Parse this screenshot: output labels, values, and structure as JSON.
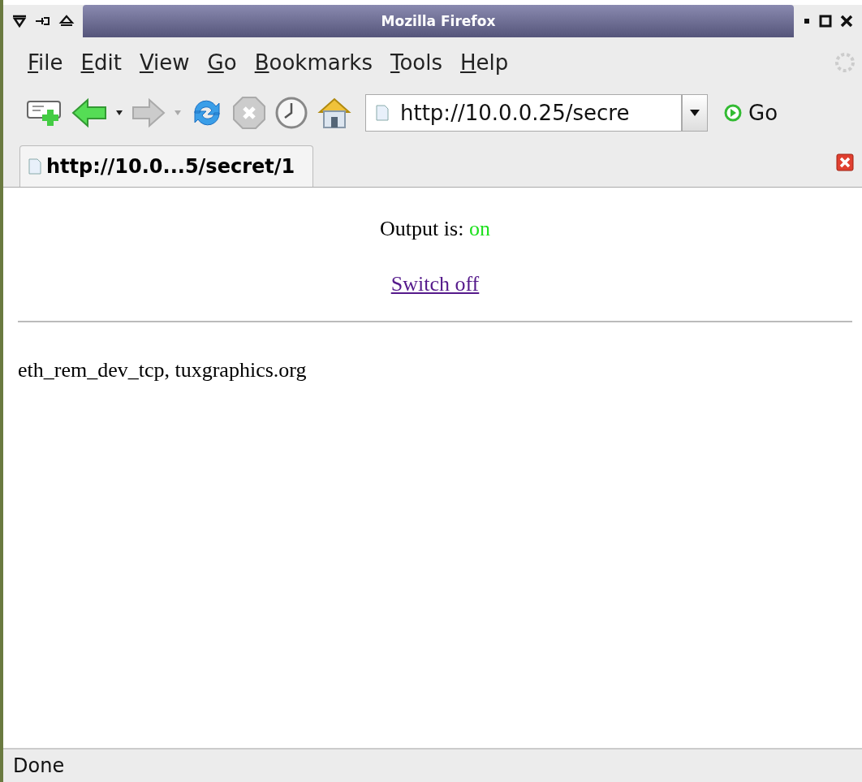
{
  "window": {
    "title": "Mozilla Firefox"
  },
  "menu": [
    "File",
    "Edit",
    "View",
    "Go",
    "Bookmarks",
    "Tools",
    "Help"
  ],
  "toolbar": {
    "url": "http://10.0.0.25/secre",
    "go_label": "Go"
  },
  "tabs": [
    {
      "label": "http://10.0...5/secret/1",
      "selected": true
    }
  ],
  "page": {
    "status_label": "Output is:",
    "status_value": "on",
    "on": true,
    "link": "Switch off",
    "footer": "eth_rem_dev_tcp, tuxgraphics.org"
  },
  "status_bar": {
    "text": "Done"
  }
}
